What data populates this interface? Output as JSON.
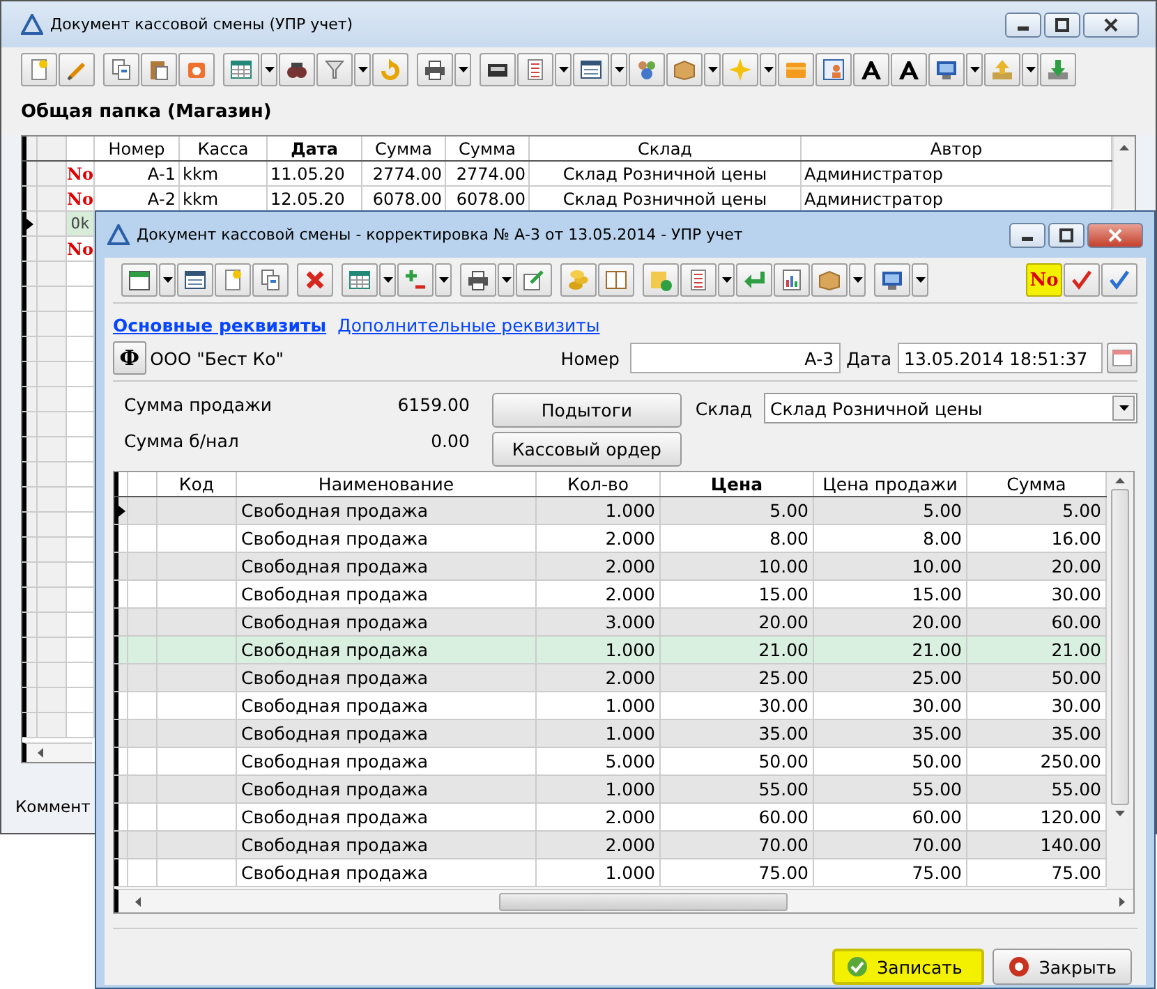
{
  "outer_window": {
    "title": "Документ кассовой смены (УПР учет)",
    "folder": "Общая папка (Магазин)",
    "table": {
      "columns": [
        {
          "label": "Номер",
          "bold": false
        },
        {
          "label": "Касса",
          "bold": false
        },
        {
          "label": "Дата",
          "bold": true
        },
        {
          "label": "Сумма",
          "bold": false
        },
        {
          "label": "Сумма",
          "bold": false
        },
        {
          "label": "Склад",
          "bold": false
        },
        {
          "label": "Автор",
          "bold": false
        }
      ],
      "rows": [
        {
          "status": "No",
          "kind": "no",
          "selected": false,
          "cells": [
            "А-1",
            "kkm",
            "11.05.20",
            "2774.00",
            "2774.00",
            "Склад Розничной цены",
            "Администратор"
          ]
        },
        {
          "status": "No",
          "kind": "no",
          "selected": false,
          "cells": [
            "А-2",
            "kkm",
            "12.05.20",
            "6078.00",
            "6078.00",
            "Склад Розничной цены",
            "Администратор"
          ]
        },
        {
          "status": "Ok",
          "kind": "ok",
          "selected": true,
          "cells": []
        },
        {
          "status": "No",
          "kind": "no",
          "selected": false,
          "cells": []
        }
      ]
    },
    "comment_label": "Коммент"
  },
  "inner_window": {
    "title": "Документ кассовой смены - корректировка № А-3 от 13.05.2014 - УПР учет",
    "status_toggle": {
      "label": "No",
      "selected": true
    },
    "tabs": [
      {
        "label": "Основные реквизиты",
        "selected": true
      },
      {
        "label": "Дополнительные реквизиты",
        "selected": false
      }
    ],
    "org_button": "Ф",
    "org": "ООО \"Бест Ко\"",
    "number_label": "Номер",
    "number": "А-3",
    "date_label": "Дата",
    "date": "13.05.2014 18:51:37",
    "summary": [
      {
        "label": "Сумма продажи",
        "value": "6159.00"
      },
      {
        "label": "Сумма б/нал",
        "value": "0.00"
      }
    ],
    "actions": [
      "Подытоги",
      "Кассовый ордер"
    ],
    "warehouse_label": "Склад",
    "warehouse": "Склад Розничной цены",
    "table": {
      "columns": [
        {
          "label": "Код",
          "bold": false
        },
        {
          "label": "Наименование",
          "bold": false
        },
        {
          "label": "Кол-во",
          "bold": false
        },
        {
          "label": "Цена",
          "bold": true
        },
        {
          "label": "Цена продажи",
          "bold": false
        },
        {
          "label": "Сумма",
          "bold": false
        }
      ],
      "rows": [
        {
          "selected": true,
          "highlighted": false,
          "cells": [
            "",
            "Свободная продажа",
            "1.000",
            "5.00",
            "5.00",
            "5.00"
          ]
        },
        {
          "selected": false,
          "highlighted": false,
          "cells": [
            "",
            "Свободная продажа",
            "2.000",
            "8.00",
            "8.00",
            "16.00"
          ]
        },
        {
          "selected": false,
          "highlighted": false,
          "cells": [
            "",
            "Свободная продажа",
            "2.000",
            "10.00",
            "10.00",
            "20.00"
          ]
        },
        {
          "selected": false,
          "highlighted": false,
          "cells": [
            "",
            "Свободная продажа",
            "2.000",
            "15.00",
            "15.00",
            "30.00"
          ]
        },
        {
          "selected": false,
          "highlighted": false,
          "cells": [
            "",
            "Свободная продажа",
            "3.000",
            "20.00",
            "20.00",
            "60.00"
          ]
        },
        {
          "selected": false,
          "highlighted": true,
          "cells": [
            "",
            "Свободная продажа",
            "1.000",
            "21.00",
            "21.00",
            "21.00"
          ]
        },
        {
          "selected": false,
          "highlighted": false,
          "cells": [
            "",
            "Свободная продажа",
            "2.000",
            "25.00",
            "25.00",
            "50.00"
          ]
        },
        {
          "selected": false,
          "highlighted": false,
          "cells": [
            "",
            "Свободная продажа",
            "1.000",
            "30.00",
            "30.00",
            "30.00"
          ]
        },
        {
          "selected": false,
          "highlighted": false,
          "cells": [
            "",
            "Свободная продажа",
            "1.000",
            "35.00",
            "35.00",
            "35.00"
          ]
        },
        {
          "selected": false,
          "highlighted": false,
          "cells": [
            "",
            "Свободная продажа",
            "5.000",
            "50.00",
            "50.00",
            "250.00"
          ]
        },
        {
          "selected": false,
          "highlighted": false,
          "cells": [
            "",
            "Свободная продажа",
            "1.000",
            "55.00",
            "55.00",
            "55.00"
          ]
        },
        {
          "selected": false,
          "highlighted": false,
          "cells": [
            "",
            "Свободная продажа",
            "2.000",
            "60.00",
            "60.00",
            "120.00"
          ]
        },
        {
          "selected": false,
          "highlighted": false,
          "cells": [
            "",
            "Свободная продажа",
            "2.000",
            "70.00",
            "70.00",
            "140.00"
          ]
        },
        {
          "selected": false,
          "highlighted": false,
          "cells": [
            "",
            "Свободная продажа",
            "1.000",
            "75.00",
            "75.00",
            "75.00"
          ]
        }
      ]
    },
    "footer_buttons": [
      {
        "label": "Записать",
        "kind": "save",
        "default": true
      },
      {
        "label": "Закрыть",
        "kind": "close",
        "default": false
      }
    ]
  }
}
